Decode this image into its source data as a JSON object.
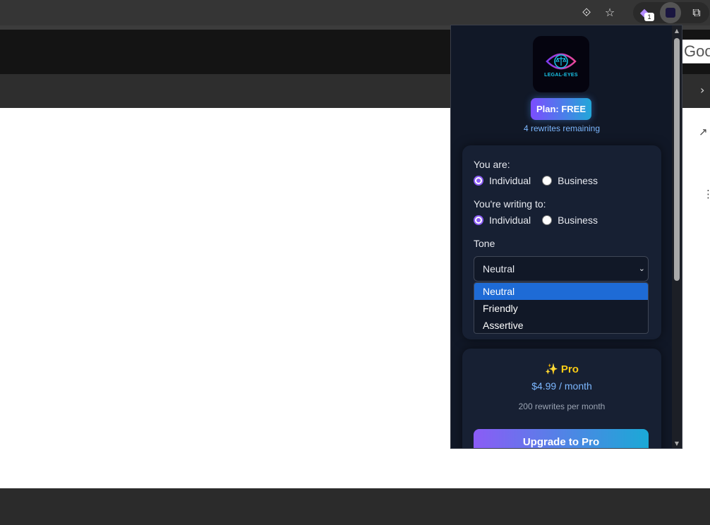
{
  "browser": {
    "extension_badge_count": "1",
    "google_chip_text": "Goog"
  },
  "popup": {
    "logo_text": "LEGAL-EYES",
    "plan_label": "Plan: FREE",
    "remaining_text": "4 rewrites remaining",
    "you_are": {
      "label": "You are:",
      "options": [
        "Individual",
        "Business"
      ],
      "selected": "Individual"
    },
    "writing_to": {
      "label": "You're writing to:",
      "options": [
        "Individual",
        "Business"
      ],
      "selected": "Individual"
    },
    "tone": {
      "label": "Tone",
      "selected": "Neutral",
      "options": [
        "Neutral",
        "Friendly",
        "Assertive"
      ]
    },
    "pro": {
      "title_icon": "✨",
      "title": "Pro",
      "price": "$4.99 / month",
      "description": "200 rewrites per month",
      "upgrade_label": "Upgrade to Pro"
    }
  },
  "colors": {
    "popup_bg": "#111827",
    "card_bg": "#172033",
    "accent_purple": "#8b5cf6",
    "accent_blue": "#22a7d8",
    "link_blue": "#7cb7ff",
    "pro_gold": "#facc15",
    "option_highlight": "#1e6bd6"
  }
}
